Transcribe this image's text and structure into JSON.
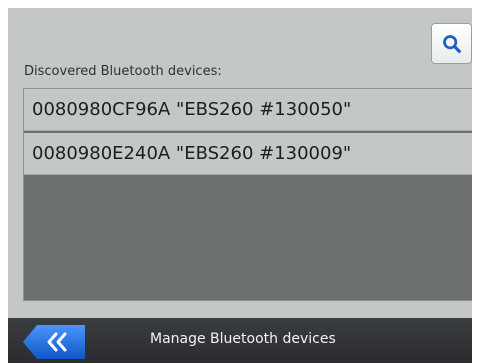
{
  "header": {
    "search_icon": "search-icon"
  },
  "devices": {
    "label": "Discovered Bluetooth devices:",
    "items": [
      {
        "label": "0080980CF96A \"EBS260 #130050\""
      },
      {
        "label": "0080980E240A \"EBS260 #130009\""
      }
    ]
  },
  "footer": {
    "title": "Manage Bluetooth devices",
    "back_icon": "double-chevron-left-icon"
  },
  "colors": {
    "background": "#c3c7c7",
    "list_background": "#6d7071",
    "footer": "#2f3235",
    "accent": "#1d6fe0"
  }
}
